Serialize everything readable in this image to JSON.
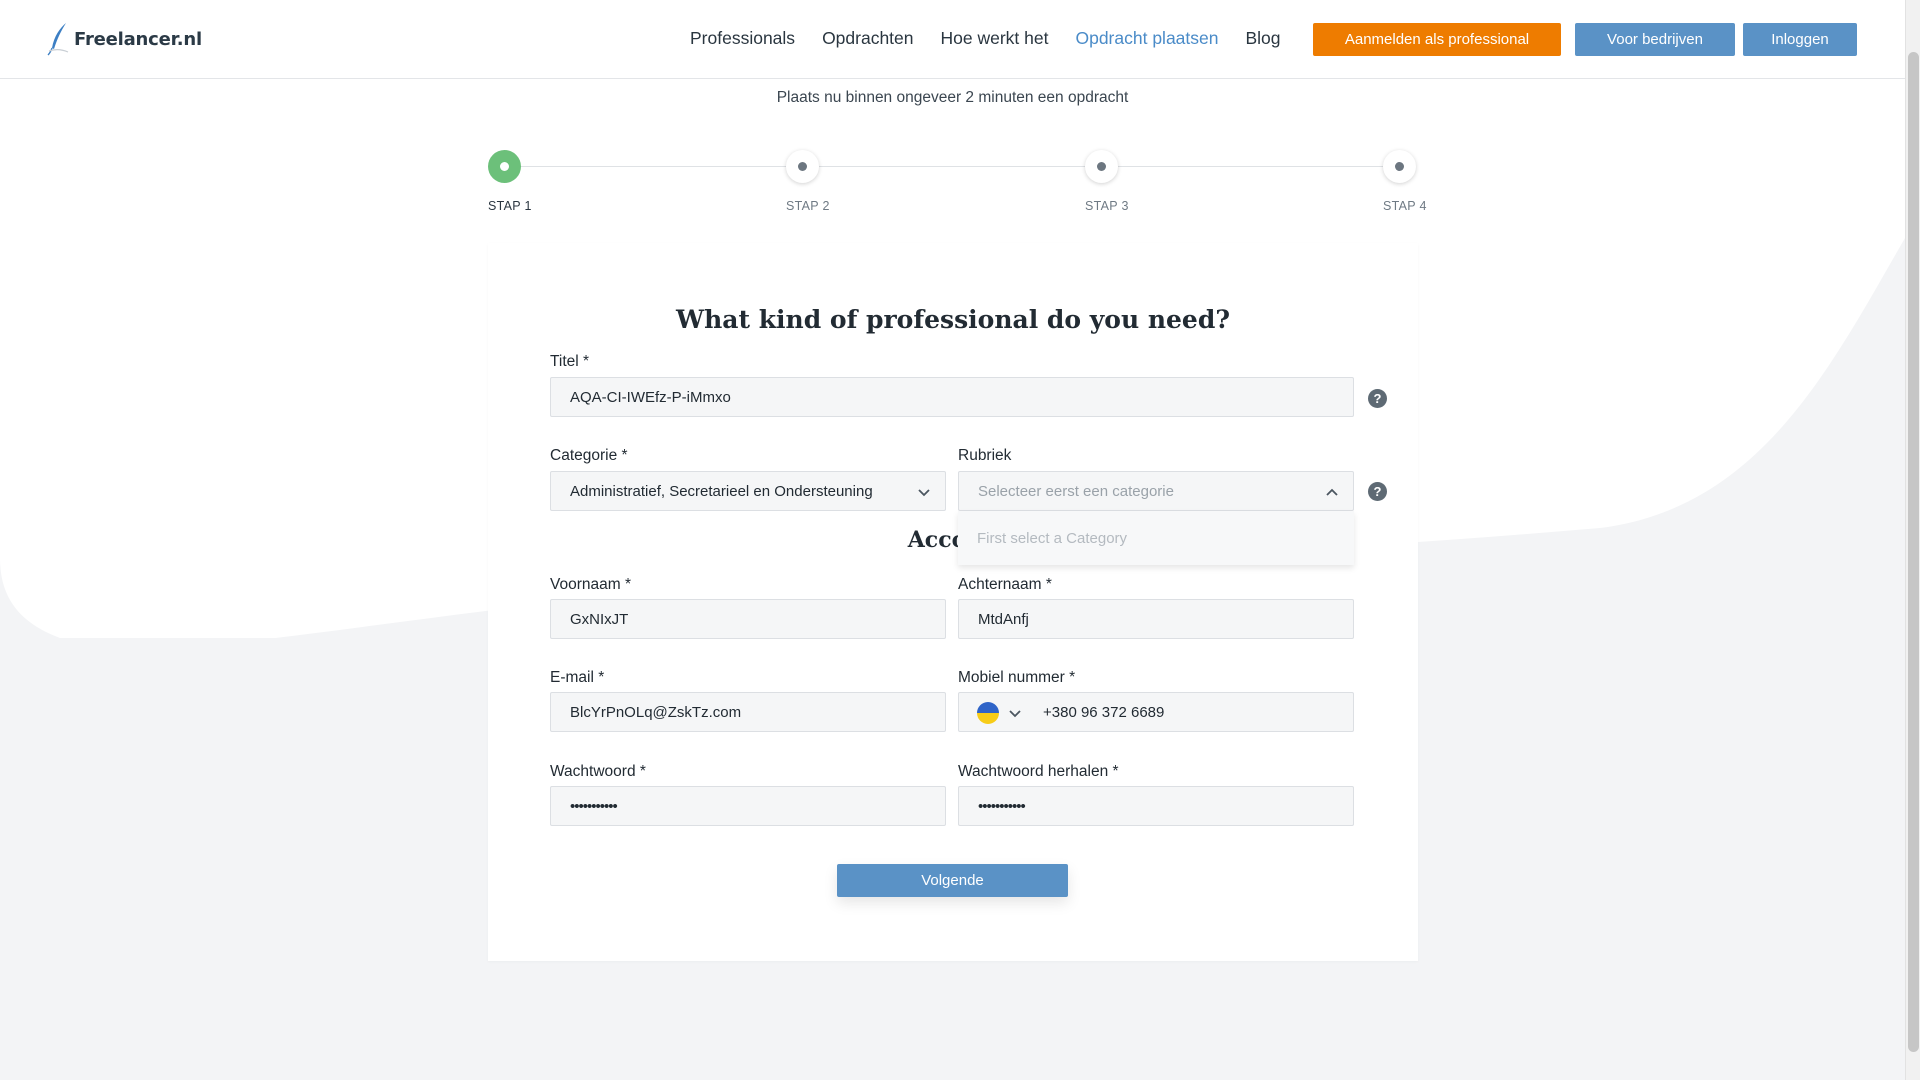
{
  "header": {
    "logo_text": "Freelancer.nl",
    "nav": [
      "Professionals",
      "Opdrachten",
      "Hoe werkt het",
      "Opdracht plaatsen",
      "Blog"
    ],
    "active_nav": "Opdracht plaatsen",
    "btn_register": "Aanmelden als professional",
    "btn_business": "Voor bedrijven",
    "btn_login": "Inloggen"
  },
  "page": {
    "subtitle": "Plaats nu binnen ongeveer 2 minuten een opdracht"
  },
  "steps": [
    "STAP 1",
    "STAP 2",
    "STAP 3",
    "STAP 4"
  ],
  "active_step": 1,
  "form": {
    "title": "What kind of professional do you need?",
    "titel_label": "Titel *",
    "titel_value": "AQA-CI-IWEfz-P-iMmxo",
    "categorie_label": "Categorie *",
    "categorie_value": "Administratief, Secretarieel en Ondersteuning",
    "rubriek_label": "Rubriek",
    "rubriek_placeholder": "Selecteer eerst een categorie",
    "rubriek_dropdown_text": "First select a Category",
    "account_section": "Accoun",
    "voornaam_label": "Voornaam *",
    "voornaam_value": "GxNIxJT",
    "achternaam_label": "Achternaam *",
    "achternaam_value": "MtdAnfj",
    "email_label": "E-mail *",
    "email_value": "BlcYrPnOLq@ZskTz.com",
    "mobiel_label": "Mobiel nummer *",
    "mobiel_value": "+380 96 372 6689",
    "wachtwoord_label": "Wachtwoord *",
    "wachtwoord_value": "•••••••••••",
    "herhalen_label": "Wachtwoord herhalen *",
    "herhalen_value": "•••••••••••",
    "help_symbol": "?",
    "submit": "Volgende"
  },
  "colors": {
    "accent_blue": "#5a92c6",
    "accent_orange": "#ee7c00",
    "step_active": "#6cc07a",
    "nav_active": "#4a8bc8"
  }
}
